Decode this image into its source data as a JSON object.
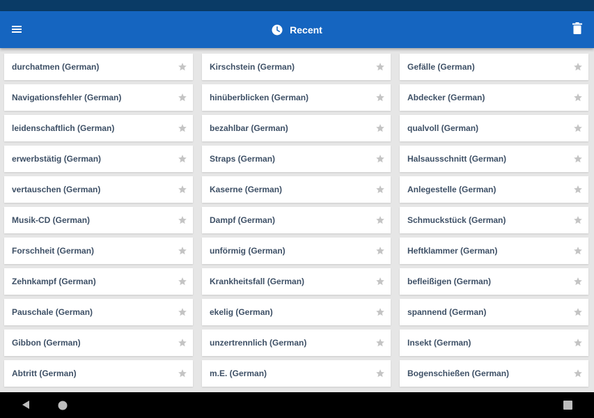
{
  "app_bar": {
    "title": "Recent",
    "title_icon": "clock-icon",
    "menu_icon": "menu-icon",
    "action_icon": "trash-icon",
    "color": "#1565c0"
  },
  "status_bar": {
    "color": "#0a3b66"
  },
  "recent_items": [
    "durchatmen (German)",
    "Kirschstein (German)",
    "Gefälle (German)",
    "Navigationsfehler (German)",
    "hinüberblicken (German)",
    "Abdecker (German)",
    "leidenschaftlich (German)",
    "bezahlbar (German)",
    "qualvoll (German)",
    "erwerbstätig (German)",
    "Straps (German)",
    "Halsausschnitt (German)",
    "vertauschen (German)",
    "Kaserne (German)",
    "Anlegestelle (German)",
    "Musik-CD (German)",
    "Dampf (German)",
    "Schmuckstück (German)",
    "Forschheit (German)",
    "unförmig (German)",
    "Heftklammer (German)",
    "Zehnkampf (German)",
    "Krankheitsfall (German)",
    "befleißigen (German)",
    "Pauschale (German)",
    "ekelig (German)",
    "spannend (German)",
    "Gibbon (German)",
    "unzertrennlich (German)",
    "Insekt (German)",
    "Abtritt (German)",
    "m.E. (German)",
    "Bogenschießen (German)"
  ],
  "item_icon": "star-icon",
  "nav_bar": {
    "back_icon": "back-triangle-icon",
    "home_icon": "home-circle-icon",
    "recents_icon": "recents-square-icon"
  }
}
